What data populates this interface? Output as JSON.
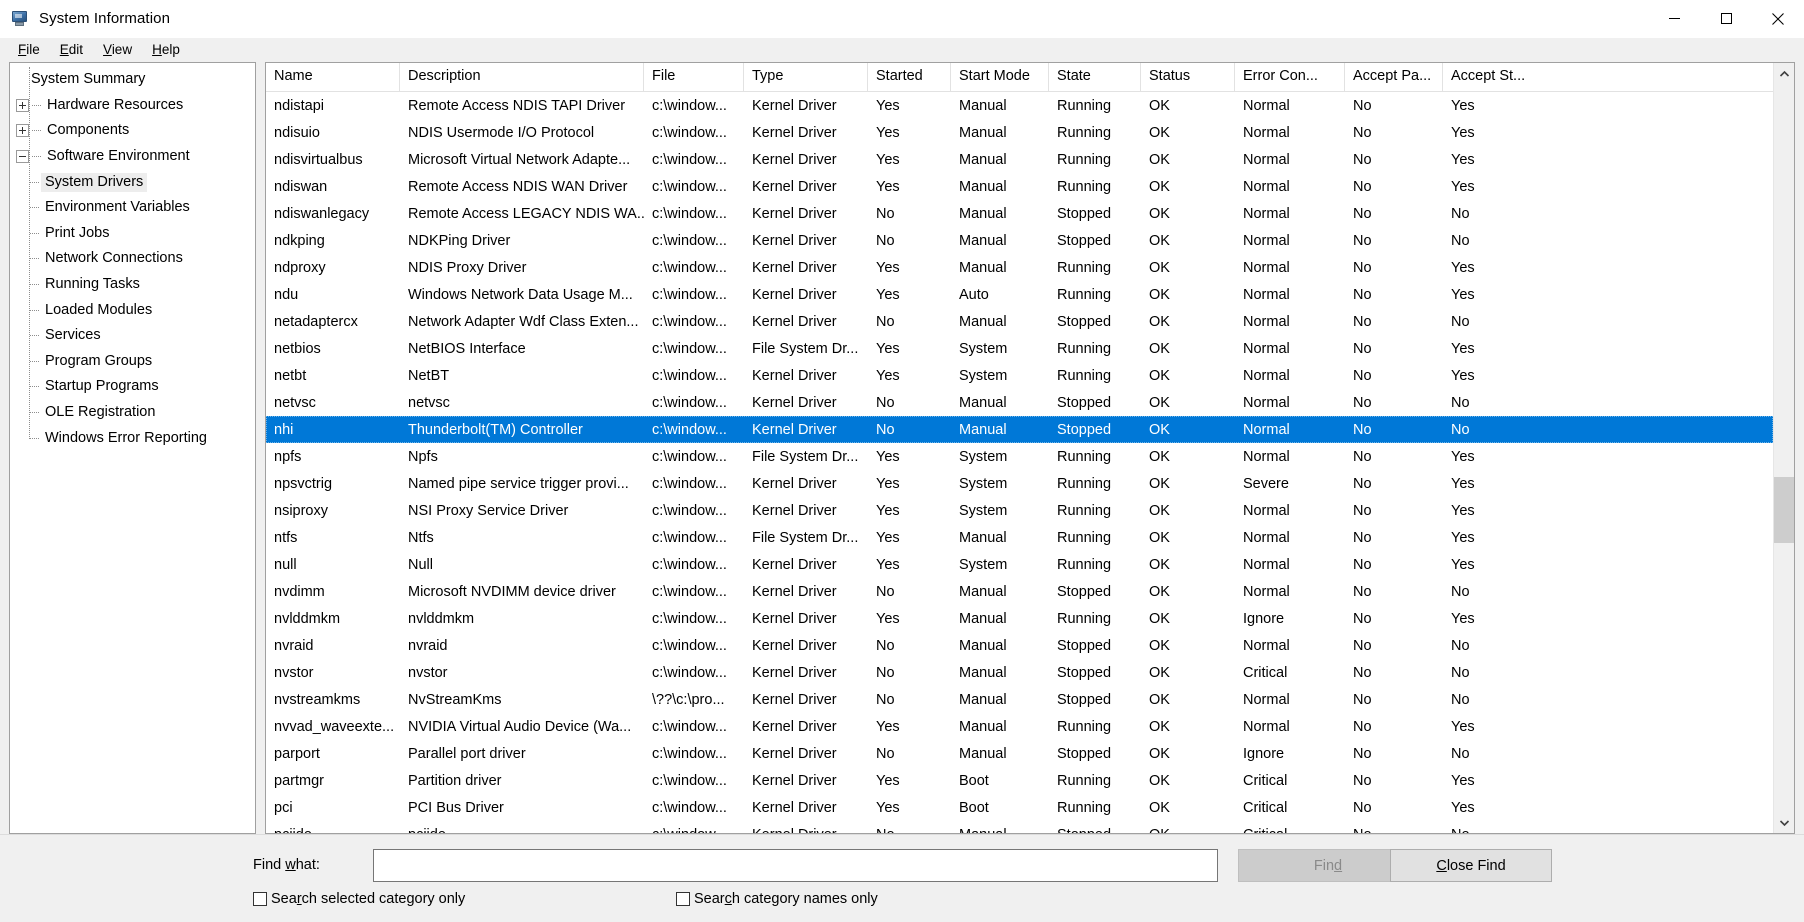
{
  "window": {
    "title": "System Information",
    "icon": "system-information-icon",
    "minimize": "minimize-icon",
    "maximize": "maximize-icon",
    "close": "close-icon"
  },
  "menu": [
    {
      "label": "File",
      "accel": "F"
    },
    {
      "label": "Edit",
      "accel": "E"
    },
    {
      "label": "View",
      "accel": "V"
    },
    {
      "label": "Help",
      "accel": "H"
    }
  ],
  "tree": [
    {
      "label": "System Summary",
      "level": 0,
      "toggle": "none",
      "selected": false
    },
    {
      "label": "Hardware Resources",
      "level": 0,
      "toggle": "plus",
      "selected": false
    },
    {
      "label": "Components",
      "level": 0,
      "toggle": "plus",
      "selected": false
    },
    {
      "label": "Software Environment",
      "level": 0,
      "toggle": "minus",
      "selected": false
    },
    {
      "label": "System Drivers",
      "level": 1,
      "toggle": "none",
      "selected": true
    },
    {
      "label": "Environment Variables",
      "level": 1,
      "toggle": "none",
      "selected": false
    },
    {
      "label": "Print Jobs",
      "level": 1,
      "toggle": "none",
      "selected": false
    },
    {
      "label": "Network Connections",
      "level": 1,
      "toggle": "none",
      "selected": false
    },
    {
      "label": "Running Tasks",
      "level": 1,
      "toggle": "none",
      "selected": false
    },
    {
      "label": "Loaded Modules",
      "level": 1,
      "toggle": "none",
      "selected": false
    },
    {
      "label": "Services",
      "level": 1,
      "toggle": "none",
      "selected": false
    },
    {
      "label": "Program Groups",
      "level": 1,
      "toggle": "none",
      "selected": false
    },
    {
      "label": "Startup Programs",
      "level": 1,
      "toggle": "none",
      "selected": false
    },
    {
      "label": "OLE Registration",
      "level": 1,
      "toggle": "none",
      "selected": false
    },
    {
      "label": "Windows Error Reporting",
      "level": 1,
      "toggle": "none",
      "selected": false
    }
  ],
  "table": {
    "columns": [
      "Name",
      "Description",
      "File",
      "Type",
      "Started",
      "Start Mode",
      "State",
      "Status",
      "Error Con...",
      "Accept Pa...",
      "Accept St..."
    ],
    "selected_index": 14,
    "rows": [
      [
        "ndistapi",
        "Remote Access NDIS TAPI Driver",
        "c:\\window...",
        "Kernel Driver",
        "Yes",
        "Manual",
        "Running",
        "OK",
        "Normal",
        "No",
        "Yes"
      ],
      [
        "ndisuio",
        "NDIS Usermode I/O Protocol",
        "c:\\window...",
        "Kernel Driver",
        "Yes",
        "Manual",
        "Running",
        "OK",
        "Normal",
        "No",
        "Yes"
      ],
      [
        "ndisvirtualbus",
        "Microsoft Virtual Network Adapte...",
        "c:\\window...",
        "Kernel Driver",
        "Yes",
        "Manual",
        "Running",
        "OK",
        "Normal",
        "No",
        "Yes"
      ],
      [
        "ndiswan",
        "Remote Access NDIS WAN Driver",
        "c:\\window...",
        "Kernel Driver",
        "Yes",
        "Manual",
        "Running",
        "OK",
        "Normal",
        "No",
        "Yes"
      ],
      [
        "ndiswanlegacy",
        "Remote Access LEGACY NDIS WA...",
        "c:\\window...",
        "Kernel Driver",
        "No",
        "Manual",
        "Stopped",
        "OK",
        "Normal",
        "No",
        "No"
      ],
      [
        "ndkping",
        "NDKPing Driver",
        "c:\\window...",
        "Kernel Driver",
        "No",
        "Manual",
        "Stopped",
        "OK",
        "Normal",
        "No",
        "No"
      ],
      [
        "ndproxy",
        "NDIS Proxy Driver",
        "c:\\window...",
        "Kernel Driver",
        "Yes",
        "Manual",
        "Running",
        "OK",
        "Normal",
        "No",
        "Yes"
      ],
      [
        "ndu",
        "Windows Network Data Usage M...",
        "c:\\window...",
        "Kernel Driver",
        "Yes",
        "Auto",
        "Running",
        "OK",
        "Normal",
        "No",
        "Yes"
      ],
      [
        "netadaptercx",
        "Network Adapter Wdf Class Exten...",
        "c:\\window...",
        "Kernel Driver",
        "No",
        "Manual",
        "Stopped",
        "OK",
        "Normal",
        "No",
        "No"
      ],
      [
        "netbios",
        "NetBIOS Interface",
        "c:\\window...",
        "File System Dr...",
        "Yes",
        "System",
        "Running",
        "OK",
        "Normal",
        "No",
        "Yes"
      ],
      [
        "netbt",
        "NetBT",
        "c:\\window...",
        "Kernel Driver",
        "Yes",
        "System",
        "Running",
        "OK",
        "Normal",
        "No",
        "Yes"
      ],
      [
        "netvsc",
        "netvsc",
        "c:\\window...",
        "Kernel Driver",
        "No",
        "Manual",
        "Stopped",
        "OK",
        "Normal",
        "No",
        "No"
      ],
      [
        "nhi",
        "Thunderbolt(TM) Controller",
        "c:\\window...",
        "Kernel Driver",
        "No",
        "Manual",
        "Stopped",
        "OK",
        "Normal",
        "No",
        "No"
      ],
      [
        "npfs",
        "Npfs",
        "c:\\window...",
        "File System Dr...",
        "Yes",
        "System",
        "Running",
        "OK",
        "Normal",
        "No",
        "Yes"
      ],
      [
        "npsvctrig",
        "Named pipe service trigger provi...",
        "c:\\window...",
        "Kernel Driver",
        "Yes",
        "System",
        "Running",
        "OK",
        "Severe",
        "No",
        "Yes"
      ],
      [
        "nsiproxy",
        "NSI Proxy Service Driver",
        "c:\\window...",
        "Kernel Driver",
        "Yes",
        "System",
        "Running",
        "OK",
        "Normal",
        "No",
        "Yes"
      ],
      [
        "ntfs",
        "Ntfs",
        "c:\\window...",
        "File System Dr...",
        "Yes",
        "Manual",
        "Running",
        "OK",
        "Normal",
        "No",
        "Yes"
      ],
      [
        "null",
        "Null",
        "c:\\window...",
        "Kernel Driver",
        "Yes",
        "System",
        "Running",
        "OK",
        "Normal",
        "No",
        "Yes"
      ],
      [
        "nvdimm",
        "Microsoft NVDIMM device driver",
        "c:\\window...",
        "Kernel Driver",
        "No",
        "Manual",
        "Stopped",
        "OK",
        "Normal",
        "No",
        "No"
      ],
      [
        "nvlddmkm",
        "nvlddmkm",
        "c:\\window...",
        "Kernel Driver",
        "Yes",
        "Manual",
        "Running",
        "OK",
        "Ignore",
        "No",
        "Yes"
      ],
      [
        "nvraid",
        "nvraid",
        "c:\\window...",
        "Kernel Driver",
        "No",
        "Manual",
        "Stopped",
        "OK",
        "Normal",
        "No",
        "No"
      ],
      [
        "nvstor",
        "nvstor",
        "c:\\window...",
        "Kernel Driver",
        "No",
        "Manual",
        "Stopped",
        "OK",
        "Critical",
        "No",
        "No"
      ],
      [
        "nvstreamkms",
        "NvStreamKms",
        "\\??\\c:\\pro...",
        "Kernel Driver",
        "No",
        "Manual",
        "Stopped",
        "OK",
        "Normal",
        "No",
        "No"
      ],
      [
        "nvvad_waveexte...",
        "NVIDIA Virtual Audio Device (Wa...",
        "c:\\window...",
        "Kernel Driver",
        "Yes",
        "Manual",
        "Running",
        "OK",
        "Normal",
        "No",
        "Yes"
      ],
      [
        "parport",
        "Parallel port driver",
        "c:\\window...",
        "Kernel Driver",
        "No",
        "Manual",
        "Stopped",
        "OK",
        "Ignore",
        "No",
        "No"
      ],
      [
        "partmgr",
        "Partition driver",
        "c:\\window...",
        "Kernel Driver",
        "Yes",
        "Boot",
        "Running",
        "OK",
        "Critical",
        "No",
        "Yes"
      ],
      [
        "pci",
        "PCI Bus Driver",
        "c:\\window...",
        "Kernel Driver",
        "Yes",
        "Boot",
        "Running",
        "OK",
        "Critical",
        "No",
        "Yes"
      ],
      [
        "pciide",
        "pciide",
        "c:\\window...",
        "Kernel Driver",
        "No",
        "Manual",
        "Stopped",
        "OK",
        "Critical",
        "No",
        "No"
      ]
    ]
  },
  "scrollbar": {
    "up_arrow": "chevron-up-icon",
    "down_arrow": "chevron-down-icon",
    "thumb_top_pct": 54,
    "thumb_height_pct": 9
  },
  "find": {
    "label": "Find what:",
    "label_accel": "w",
    "input_value": "",
    "input_placeholder": "",
    "find_button": "Find",
    "find_button_accel": "d",
    "find_button_disabled": true,
    "close_button": "Close Find",
    "close_button_accel": "C",
    "checkbox_selected_category": "Search selected category only",
    "checkbox_selected_category_accel": "r",
    "checkbox_selected_category_checked": false,
    "checkbox_category_names": "Search category names only",
    "checkbox_category_names_accel": "c",
    "checkbox_category_names_checked": false
  },
  "colors": {
    "selection_blue": "#0078d7",
    "window_bg": "#f0f0f0",
    "list_bg": "#ffffff",
    "tree_selected_bg": "#ededed"
  }
}
